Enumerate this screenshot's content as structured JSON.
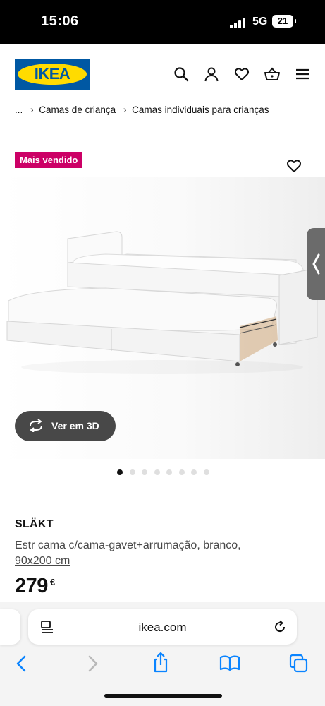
{
  "status_bar": {
    "time": "15:06",
    "network": "5G",
    "battery": "21"
  },
  "header": {
    "logo_text": "IKEA"
  },
  "breadcrumb": {
    "ellipsis": "...",
    "items": [
      "Camas de criança",
      "Camas individuais para crianças"
    ]
  },
  "badge": "Mais vendido",
  "view3d_label": "Ver em 3D",
  "carousel": {
    "count": 8,
    "active_index": 0
  },
  "product": {
    "name": "SLÄKT",
    "description": "Estr cama c/cama-gavet+arrumação, branco,",
    "size": "90x200 cm",
    "price": "279",
    "currency": "€"
  },
  "browser": {
    "url": "ikea.com"
  },
  "colors": {
    "brand_blue": "#0058a3",
    "brand_yellow": "#ffdb00",
    "badge": "#cc0066",
    "link_blue": "#0a84ff"
  },
  "icons": [
    "search-icon",
    "user-icon",
    "heart-icon",
    "basket-icon",
    "menu-icon",
    "rotate-3d-icon",
    "reader-icon",
    "reload-icon",
    "back-icon",
    "forward-icon",
    "share-icon",
    "bookmarks-icon",
    "tabs-icon"
  ]
}
